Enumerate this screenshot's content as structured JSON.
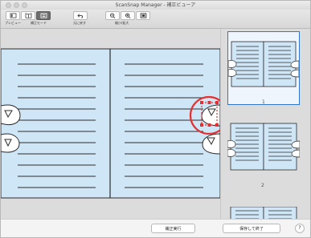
{
  "window": {
    "title": "ScanSnap Manager - 補正ビューア"
  },
  "toolbar": {
    "labels": {
      "preview": "プレビュー",
      "correction_mode": "補正モード",
      "undo": "元に戻す",
      "zoom": "縮小/拡大"
    }
  },
  "thumbnails": {
    "items": [
      {
        "number": "1"
      },
      {
        "number": "2"
      }
    ]
  },
  "footer": {
    "apply_label": "補正実行",
    "save_exit_label": "保存して終了",
    "help_label": "?"
  },
  "colors": {
    "page_blue": "#cfe6f7",
    "accent": "#2f76cc",
    "marker_red": "#e53030"
  }
}
